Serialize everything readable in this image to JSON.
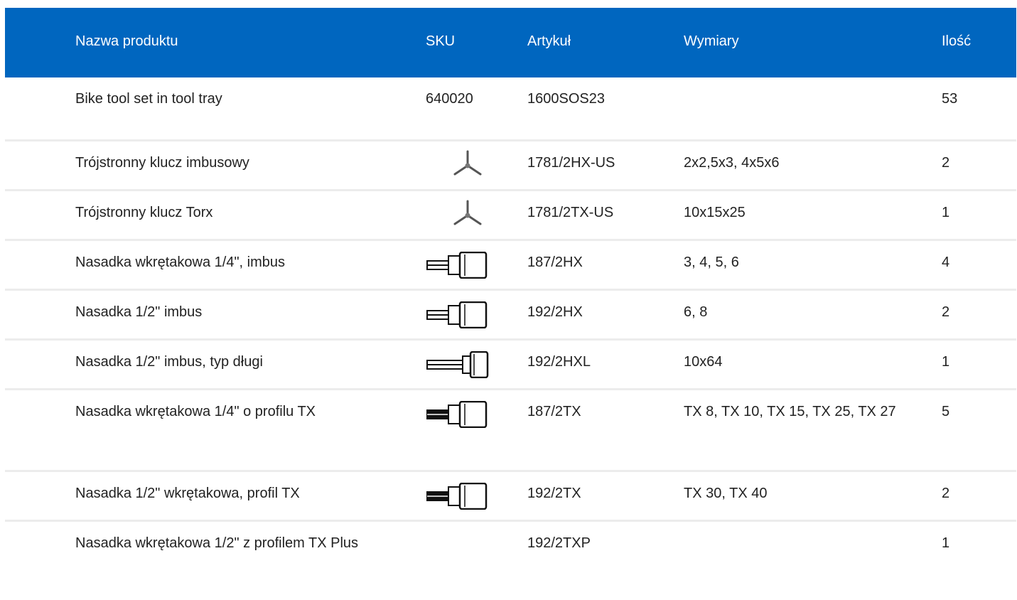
{
  "columns": {
    "name": "Nazwa produktu",
    "sku": "SKU",
    "article": "Artykuł",
    "dimensions": "Wymiary",
    "quantity": "Ilość"
  },
  "rows": [
    {
      "name": "Bike tool set in tool tray",
      "sku": "640020",
      "icon": "",
      "article": "1600SOS23",
      "dimensions": "",
      "quantity": "53"
    },
    {
      "name": "Trójstronny klucz imbusowy",
      "sku": "",
      "icon": "y-hex-key-icon",
      "article": "1781/2HX-US",
      "dimensions": "2x2,5x3, 4x5x6",
      "quantity": "2"
    },
    {
      "name": "Trójstronny klucz Torx",
      "sku": "",
      "icon": "y-torx-key-icon",
      "article": "1781/2TX-US",
      "dimensions": "10x15x25",
      "quantity": "1"
    },
    {
      "name": "Nasadka wkrętakowa 1/4\", imbus",
      "sku": "",
      "icon": "hex-bit-socket-icon",
      "article": "187/2HX",
      "dimensions": "3, 4, 5, 6",
      "quantity": "4"
    },
    {
      "name": "Nasadka 1/2\" imbus",
      "sku": "",
      "icon": "hex-bit-socket-icon",
      "article": "192/2HX",
      "dimensions": "6, 8",
      "quantity": "2"
    },
    {
      "name": "Nasadka 1/2\" imbus, typ długi",
      "sku": "",
      "icon": "long-hex-bit-socket-icon",
      "article": "192/2HXL",
      "dimensions": "10x64",
      "quantity": "1"
    },
    {
      "name": "Nasadka wkrętakowa 1/4\" o profilu TX",
      "sku": "",
      "icon": "torx-bit-socket-icon",
      "article": "187/2TX",
      "dimensions": "TX 8, TX 10, TX 15, TX 25, TX 27",
      "quantity": "5"
    },
    {
      "name": "Nasadka 1/2\" wkrętakowa, profil TX",
      "sku": "",
      "icon": "torx-bit-socket-icon",
      "article": "192/2TX",
      "dimensions": "TX 30, TX 40",
      "quantity": "2"
    },
    {
      "name": "Nasadka wkrętakowa 1/2\" z profilem TX Plus",
      "sku": "",
      "icon": "",
      "article": "192/2TXP",
      "dimensions": "",
      "quantity": "1"
    }
  ]
}
